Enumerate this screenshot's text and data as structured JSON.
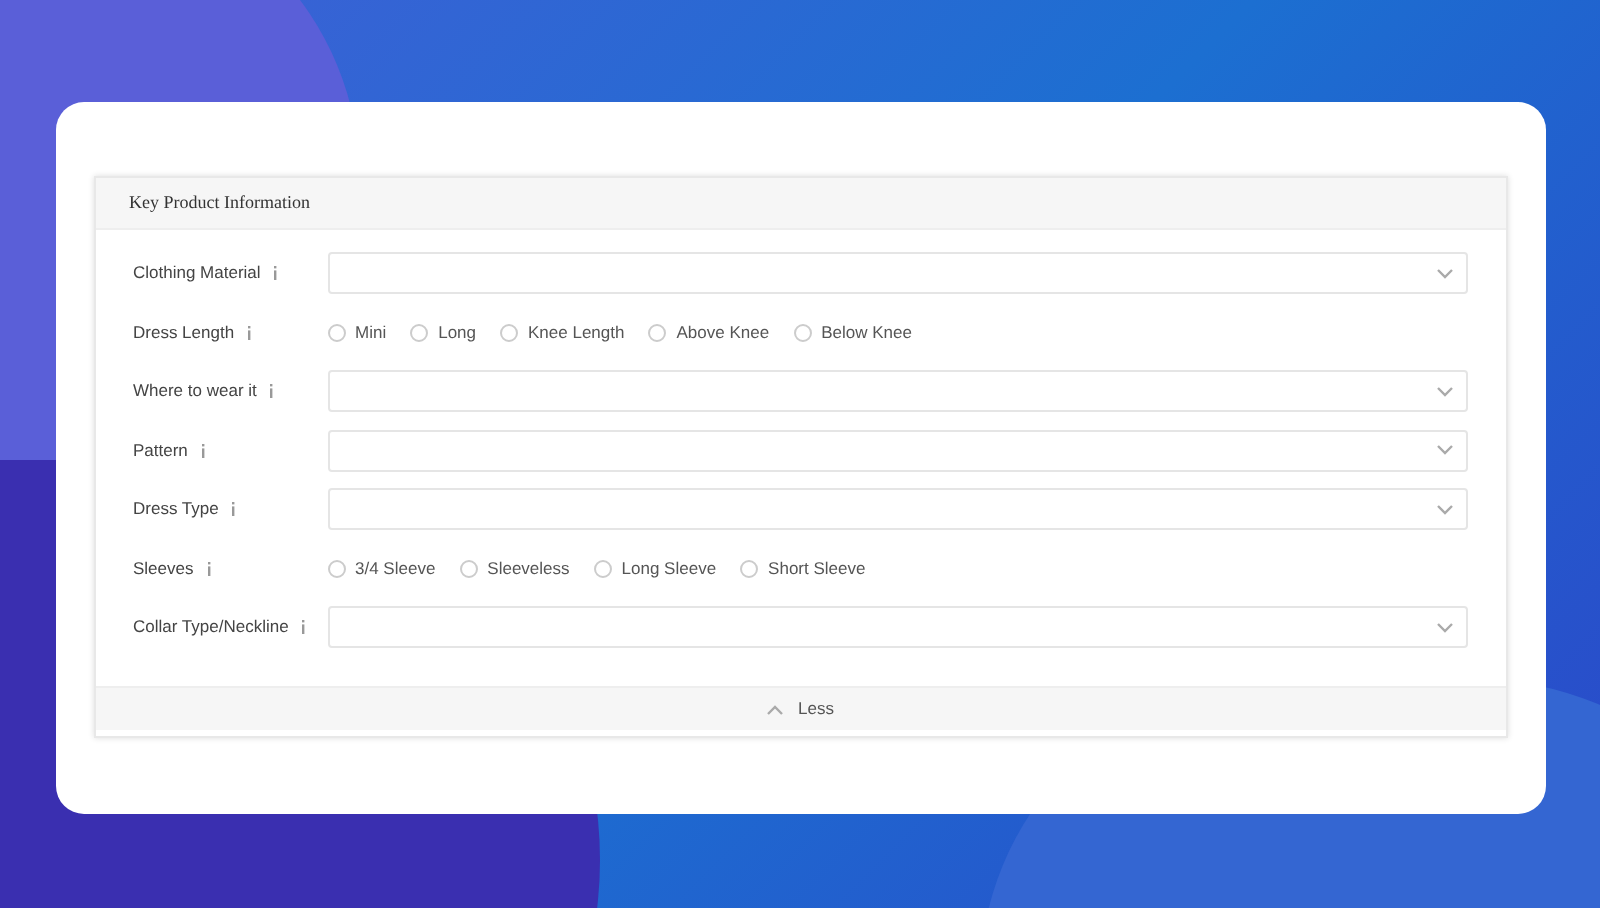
{
  "panel": {
    "title": "Key Product Information"
  },
  "fields": [
    {
      "label": "Clothing Material",
      "kind": "select"
    },
    {
      "label": "Dress Length",
      "kind": "radio",
      "options": [
        {
          "label": "Mini",
          "selected": false
        },
        {
          "label": "Long",
          "selected": false
        },
        {
          "label": "Knee Length",
          "selected": false
        },
        {
          "label": "Above Knee",
          "selected": false
        },
        {
          "label": "Below Knee",
          "selected": false
        }
      ]
    },
    {
      "label": "Where to wear it",
      "kind": "select"
    },
    {
      "label": "Pattern",
      "kind": "select"
    },
    {
      "label": "Dress Type",
      "kind": "select"
    },
    {
      "label": "Sleeves",
      "kind": "radio",
      "options": [
        {
          "label": "3/4 Sleeve",
          "selected": false
        },
        {
          "label": "Sleeveless",
          "selected": false
        },
        {
          "label": "Long Sleeve",
          "selected": false
        },
        {
          "label": "Short Sleeve",
          "selected": false
        }
      ]
    },
    {
      "label": "Collar Type/Neckline",
      "kind": "select"
    }
  ],
  "toggle": {
    "label": "Less",
    "expanded": true
  }
}
